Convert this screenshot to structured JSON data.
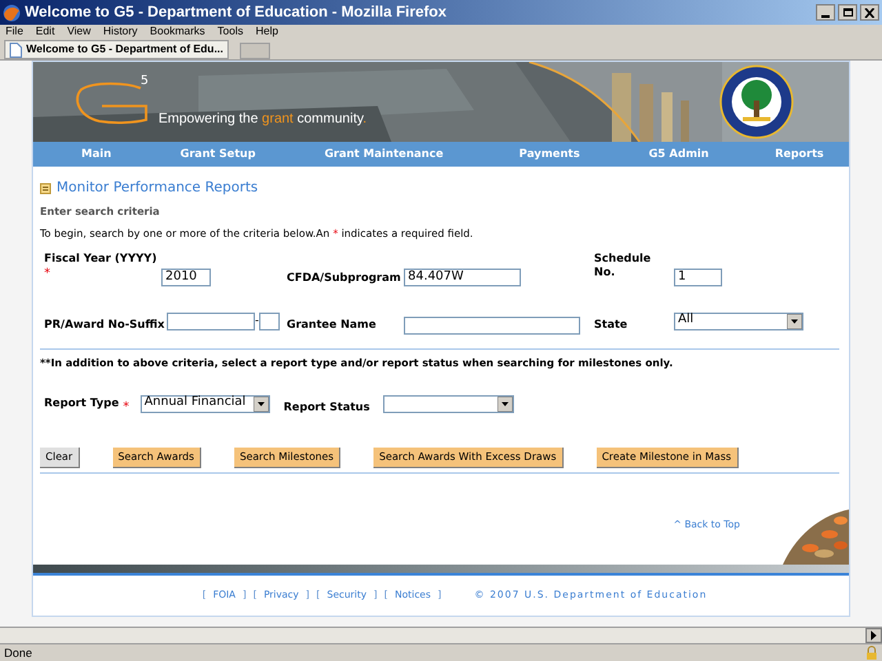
{
  "window": {
    "title": "Welcome to G5 - Department of Education - Mozilla Firefox"
  },
  "menu": [
    "File",
    "Edit",
    "View",
    "History",
    "Bookmarks",
    "Tools",
    "Help"
  ],
  "tabs": [
    {
      "label": "Welcome to G5 - Department of Edu...",
      "selected": true
    }
  ],
  "header": {
    "logo_superscript": "5",
    "tagline": [
      {
        "text": "Empowering the ",
        "highlight": false
      },
      {
        "text": "grant",
        "highlight": true
      },
      {
        "text": " community",
        "highlight": false
      },
      {
        "text": ".",
        "highlight": true
      }
    ]
  },
  "nav": [
    "Main",
    "Grant Setup",
    "Grant Maintenance",
    "Payments",
    "G5 Admin",
    "Reports"
  ],
  "page": {
    "heading": "Monitor Performance Reports",
    "subheading": "Enter search criteria",
    "instructions": [
      {
        "text": "To begin, search by one or more of the criteria below.An ",
        "required": false
      },
      {
        "text": "*",
        "required": true
      },
      {
        "text": " indicates a required field.",
        "required": false
      }
    ],
    "fiscal_year": {
      "label": "Fiscal Year (YYYY)",
      "required_mark": "*",
      "value": "2010"
    },
    "cfda": {
      "label": "CFDA/Subprogram",
      "value": "84.407W"
    },
    "schedule": {
      "label": "Schedule No.",
      "value": "1"
    },
    "award": {
      "label": "PR/Award No-Suffix",
      "separator": "-"
    },
    "grantee": {
      "label": "Grantee Name"
    },
    "state": {
      "label": "State",
      "value": "All"
    },
    "note": "**In addition to above criteria, select a report type and/or report status when searching for milestones only.",
    "report_type": {
      "label": "Report Type",
      "required_mark": "*",
      "value": "Annual Financial"
    },
    "report_status": {
      "label": "Report Status"
    },
    "buttons": [
      {
        "label": "Clear",
        "kind": "plain"
      },
      {
        "label": "Search Awards",
        "kind": "action"
      },
      {
        "label": "Search Milestones",
        "kind": "action"
      },
      {
        "label": "Search Awards With Excess Draws",
        "kind": "action"
      },
      {
        "label": "Create Milestone in Mass",
        "kind": "action"
      }
    ],
    "back_to_top": "^ Back to Top"
  },
  "footer": {
    "items": [
      {
        "text": "[",
        "kind": "bracket"
      },
      {
        "text": "FOIA",
        "kind": "link"
      },
      {
        "text": "]",
        "kind": "bracket"
      },
      {
        "text": "[",
        "kind": "bracket"
      },
      {
        "text": "Privacy",
        "kind": "link"
      },
      {
        "text": "]",
        "kind": "bracket"
      },
      {
        "text": "[",
        "kind": "bracket"
      },
      {
        "text": "Security",
        "kind": "link"
      },
      {
        "text": "]",
        "kind": "bracket"
      },
      {
        "text": "[",
        "kind": "bracket"
      },
      {
        "text": "Notices",
        "kind": "link"
      },
      {
        "text": "]",
        "kind": "bracket"
      }
    ],
    "copyright": "© 2007 U.S. Department of Education"
  },
  "status_bar": "Done"
}
